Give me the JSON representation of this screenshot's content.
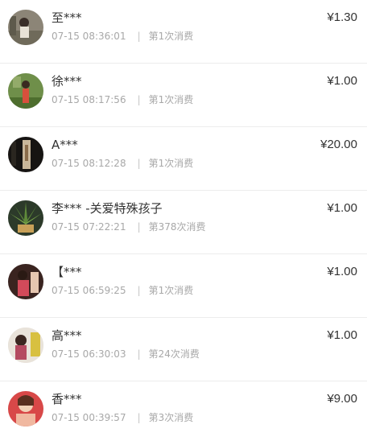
{
  "records": [
    {
      "name": "至***",
      "time": "07-15 08:36:01",
      "separator": "|",
      "count": "第1次消费",
      "amount": "¥1.30",
      "avatar": "avatar-1"
    },
    {
      "name": "徐***",
      "time": "07-15 08:17:56",
      "separator": "|",
      "count": "第1次消费",
      "amount": "¥1.00",
      "avatar": "avatar-2"
    },
    {
      "name": "A***",
      "time": "07-15 08:12:28",
      "separator": "|",
      "count": "第1次消费",
      "amount": "¥20.00",
      "avatar": "avatar-3"
    },
    {
      "name": "李*** -关爱特殊孩子",
      "time": "07-15 07:22:21",
      "separator": "|",
      "count": "第378次消费",
      "amount": "¥1.00",
      "avatar": "avatar-4"
    },
    {
      "name": "【***",
      "time": "07-15 06:59:25",
      "separator": "|",
      "count": "第1次消费",
      "amount": "¥1.00",
      "avatar": "avatar-5"
    },
    {
      "name": "高***",
      "time": "07-15 06:30:03",
      "separator": "|",
      "count": "第24次消费",
      "amount": "¥1.00",
      "avatar": "avatar-6"
    },
    {
      "name": "香***",
      "time": "07-15 00:39:57",
      "separator": "|",
      "count": "第3次消费",
      "amount": "¥9.00",
      "avatar": "avatar-7"
    }
  ]
}
